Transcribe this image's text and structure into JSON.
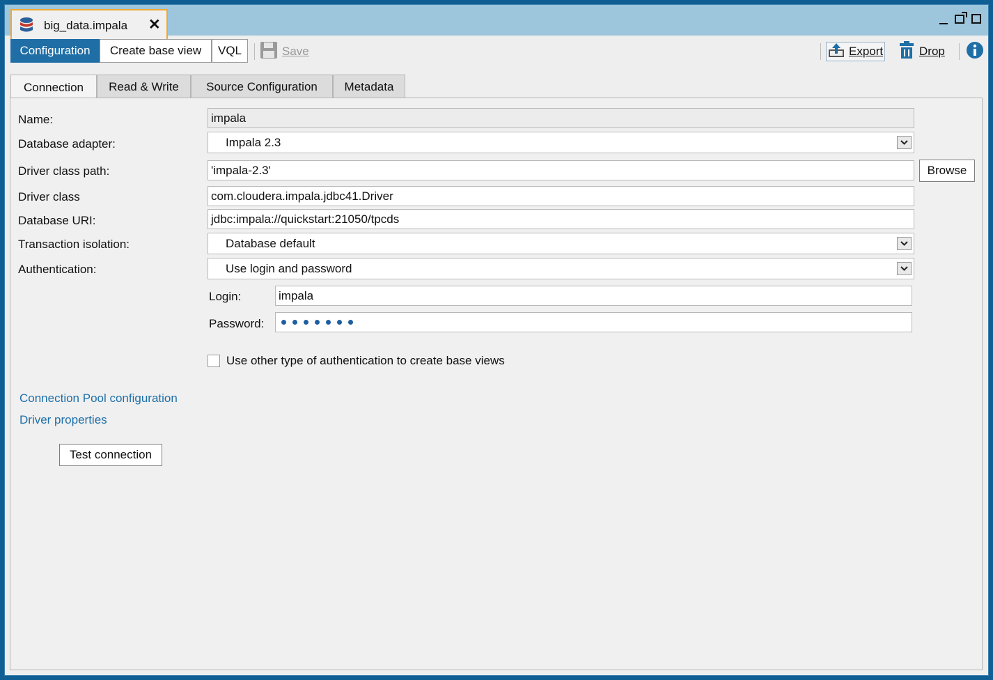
{
  "window": {
    "tab_title": "big_data.impala"
  },
  "toolbar": {
    "modes": [
      "Configuration",
      "Create base view",
      "VQL"
    ],
    "save_label": "Save",
    "export_label": "Export",
    "drop_label": "Drop"
  },
  "tabs": [
    "Connection",
    "Read & Write",
    "Source Configuration",
    "Metadata"
  ],
  "form": {
    "name_label": "Name:",
    "name_value": "impala",
    "adapter_label": "Database adapter:",
    "adapter_value": "Impala 2.3",
    "class_path_label": "Driver class path:",
    "class_path_value": "'impala-2.3'",
    "browse_label": "Browse",
    "driver_class_label": "Driver class",
    "driver_class_value": "com.cloudera.impala.jdbc41.Driver",
    "uri_label": "Database URI:",
    "uri_value": "jdbc:impala://quickstart:21050/tpcds",
    "isolation_label": "Transaction isolation:",
    "isolation_value": "Database default",
    "auth_label": "Authentication:",
    "auth_value": "Use login and password",
    "login_label": "Login:",
    "login_value": "impala",
    "password_label": "Password:",
    "password_mask_length": 7,
    "other_auth_label": "Use other type of authentication to create base views",
    "other_auth_checked": false
  },
  "links": {
    "pool": "Connection Pool configuration",
    "driver_props": "Driver properties"
  },
  "test_button": "Test connection",
  "colors": {
    "accent": "#1f6ea6",
    "link": "#1d6fa8",
    "tab_highlight": "#f0a830"
  }
}
